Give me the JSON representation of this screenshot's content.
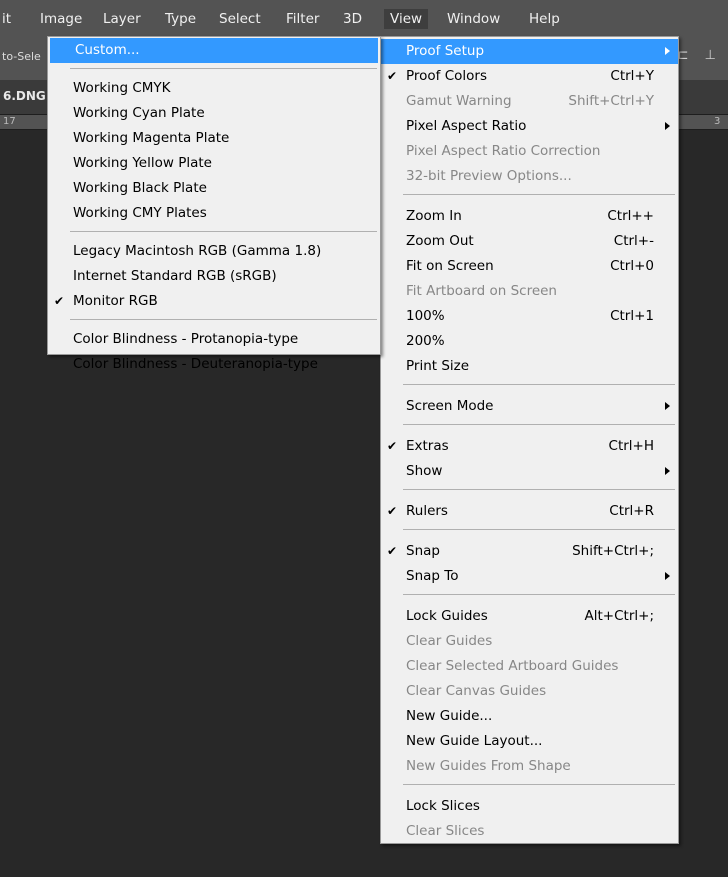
{
  "menubar": {
    "items": [
      {
        "label": "it",
        "active": false
      },
      {
        "label": "Image",
        "active": false
      },
      {
        "label": "Layer",
        "active": false
      },
      {
        "label": "Type",
        "active": false
      },
      {
        "label": "Select",
        "active": false
      },
      {
        "label": "Filter",
        "active": false
      },
      {
        "label": "3D",
        "active": false
      },
      {
        "label": "View",
        "active": true
      },
      {
        "label": "Window",
        "active": false
      },
      {
        "label": "Help",
        "active": false
      }
    ]
  },
  "options_bar": {
    "auto_select_fragment": "to-Sele"
  },
  "doc_tab": {
    "title_fragment": "6.DNG"
  },
  "ruler": {
    "left_label": "17",
    "right_label": "3"
  },
  "view_menu": {
    "items": [
      {
        "type": "item",
        "label": "Proof Setup",
        "submenu": true,
        "highlighted": true
      },
      {
        "type": "item",
        "label": "Proof Colors",
        "shortcut": "Ctrl+Y",
        "checked": true
      },
      {
        "type": "item",
        "label": "Gamut Warning",
        "shortcut": "Shift+Ctrl+Y",
        "disabled": true
      },
      {
        "type": "item",
        "label": "Pixel Aspect Ratio",
        "submenu": true
      },
      {
        "type": "item",
        "label": "Pixel Aspect Ratio Correction",
        "disabled": true
      },
      {
        "type": "item",
        "label": "32-bit Preview Options...",
        "disabled": true
      },
      {
        "type": "sep"
      },
      {
        "type": "item",
        "label": "Zoom In",
        "shortcut": "Ctrl++"
      },
      {
        "type": "item",
        "label": "Zoom Out",
        "shortcut": "Ctrl+-"
      },
      {
        "type": "item",
        "label": "Fit on Screen",
        "shortcut": "Ctrl+0"
      },
      {
        "type": "item",
        "label": "Fit Artboard on Screen",
        "disabled": true
      },
      {
        "type": "item",
        "label": "100%",
        "shortcut": "Ctrl+1"
      },
      {
        "type": "item",
        "label": "200%"
      },
      {
        "type": "item",
        "label": "Print Size"
      },
      {
        "type": "sep"
      },
      {
        "type": "item",
        "label": "Screen Mode",
        "submenu": true
      },
      {
        "type": "sep"
      },
      {
        "type": "item",
        "label": "Extras",
        "shortcut": "Ctrl+H",
        "checked": true
      },
      {
        "type": "item",
        "label": "Show",
        "submenu": true
      },
      {
        "type": "sep"
      },
      {
        "type": "item",
        "label": "Rulers",
        "shortcut": "Ctrl+R",
        "checked": true
      },
      {
        "type": "sep"
      },
      {
        "type": "item",
        "label": "Snap",
        "shortcut": "Shift+Ctrl+;",
        "checked": true
      },
      {
        "type": "item",
        "label": "Snap To",
        "submenu": true
      },
      {
        "type": "sep"
      },
      {
        "type": "item",
        "label": "Lock Guides",
        "shortcut": "Alt+Ctrl+;"
      },
      {
        "type": "item",
        "label": "Clear Guides",
        "disabled": true
      },
      {
        "type": "item",
        "label": "Clear Selected Artboard Guides",
        "disabled": true
      },
      {
        "type": "item",
        "label": "Clear Canvas Guides",
        "disabled": true
      },
      {
        "type": "item",
        "label": "New Guide..."
      },
      {
        "type": "item",
        "label": "New Guide Layout..."
      },
      {
        "type": "item",
        "label": "New Guides From Shape",
        "disabled": true
      },
      {
        "type": "sep"
      },
      {
        "type": "item",
        "label": "Lock Slices"
      },
      {
        "type": "item",
        "label": "Clear Slices",
        "disabled": true
      }
    ]
  },
  "proof_setup_submenu": {
    "items": [
      {
        "type": "item",
        "label": "Custom...",
        "highlighted": true
      },
      {
        "type": "sep"
      },
      {
        "type": "item",
        "label": "Working CMYK"
      },
      {
        "type": "item",
        "label": "Working Cyan Plate"
      },
      {
        "type": "item",
        "label": "Working Magenta Plate"
      },
      {
        "type": "item",
        "label": "Working Yellow Plate"
      },
      {
        "type": "item",
        "label": "Working Black Plate"
      },
      {
        "type": "item",
        "label": "Working CMY Plates"
      },
      {
        "type": "sep"
      },
      {
        "type": "item",
        "label": "Legacy Macintosh RGB (Gamma 1.8)"
      },
      {
        "type": "item",
        "label": "Internet Standard RGB (sRGB)"
      },
      {
        "type": "item",
        "label": "Monitor RGB",
        "checked": true
      },
      {
        "type": "sep"
      },
      {
        "type": "item",
        "label": "Color Blindness - Protanopia-type"
      },
      {
        "type": "item",
        "label": "Color Blindness - Deuteranopia-type"
      }
    ]
  }
}
